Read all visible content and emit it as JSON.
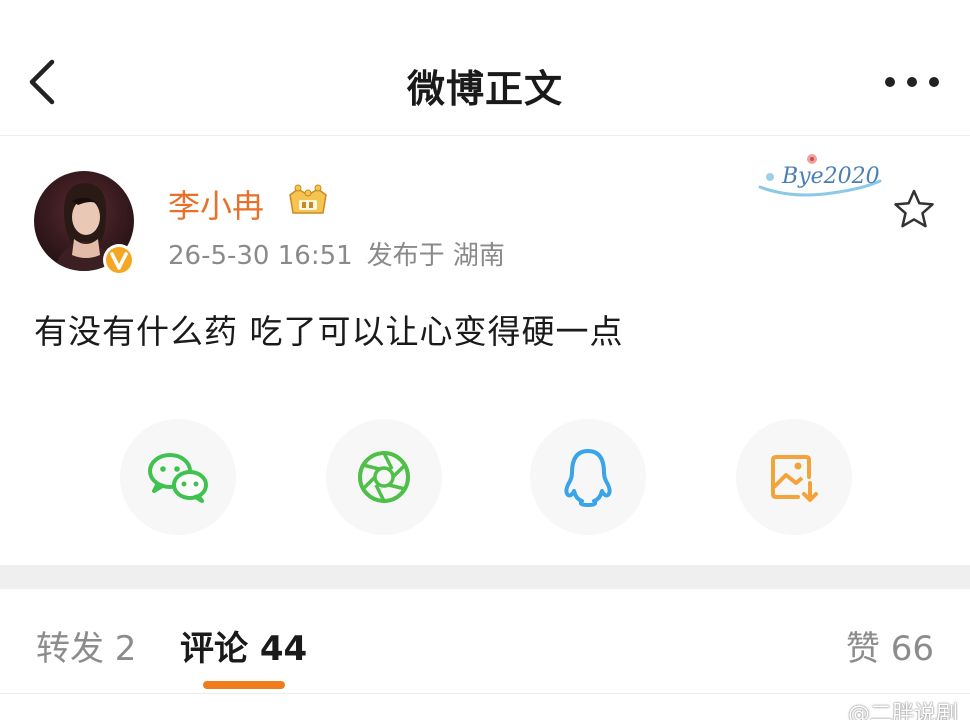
{
  "nav": {
    "title": "微博正文"
  },
  "post": {
    "username": "李小冉",
    "timestamp": "26-5-30 16:51",
    "location": "发布于 湖南",
    "text": "有没有什么药 吃了可以让心变得硬一点",
    "sticker_text": "Bye2020"
  },
  "share": {
    "items": [
      {
        "name": "wechat",
        "icon": "wechat-icon",
        "color": "#3fc24f"
      },
      {
        "name": "moments",
        "icon": "moments-aperture-icon",
        "color": "#4fbf4a"
      },
      {
        "name": "qq",
        "icon": "qq-penguin-icon",
        "color": "#3aa4e8"
      },
      {
        "name": "save-image",
        "icon": "image-download-icon",
        "color": "#f2a33a"
      }
    ]
  },
  "tabs": {
    "repost": "转发 2",
    "comment": "评论 44",
    "like": "赞 66"
  },
  "watermark": {
    "text": "@二胖说剧"
  },
  "colors": {
    "accent": "#f07d1b",
    "username": "#e8702a",
    "meta": "#8a8a8a"
  }
}
